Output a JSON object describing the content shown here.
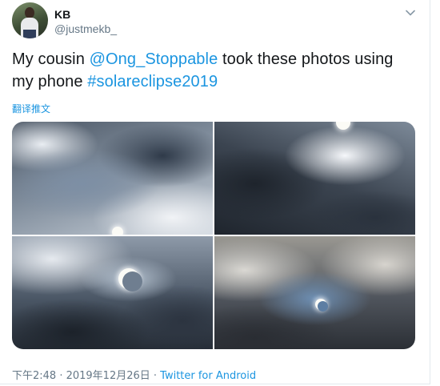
{
  "author": {
    "name": "KB",
    "handle": "@justmekb_"
  },
  "tweet": {
    "text_part1": "My cousin ",
    "mention": "@Ong_Stoppable",
    "text_part2": " took these photos using my phone ",
    "hashtag": "#solareclipse2019"
  },
  "translate_label": "翻译推文",
  "photos": [
    {
      "alt": "eclipse-photo-1"
    },
    {
      "alt": "eclipse-photo-2"
    },
    {
      "alt": "eclipse-photo-3"
    },
    {
      "alt": "eclipse-photo-4"
    }
  ],
  "footer": {
    "timestamp": "下午2:48 · 2019年12月26日 · ",
    "source": "Twitter for Android"
  },
  "icons": {
    "menu": "chevron-down-icon"
  },
  "colors": {
    "link": "#1b95e0",
    "secondary_text": "#657786"
  }
}
